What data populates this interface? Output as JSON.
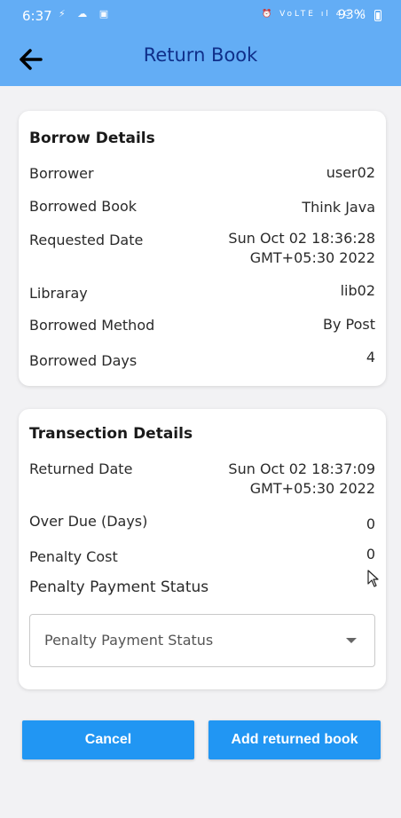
{
  "status_bar": {
    "time": "6:37",
    "left_icons": "⚡ ☁ ▣",
    "right_icons": "⏰ VoLTE ıl 4G ıl",
    "battery": "93%"
  },
  "header": {
    "title": "Return Book",
    "back_icon": "arrow-left-icon"
  },
  "borrow_details": {
    "title": "Borrow Details",
    "rows": [
      {
        "label": "Borrower",
        "value": "user02"
      },
      {
        "label": "Borrowed Book",
        "value": "Think Java"
      },
      {
        "label": "Requested Date",
        "value_line1": "Sun Oct 02 18:36:28",
        "value_line2": "GMT+05:30 2022"
      },
      {
        "label": "Libraray",
        "value": "lib02"
      },
      {
        "label": "Borrowed Method",
        "value": "By Post"
      },
      {
        "label": "Borrowed Days",
        "value": "4"
      }
    ]
  },
  "transaction_details": {
    "title": "Transection Details",
    "rows": [
      {
        "label": "Returned Date",
        "value_line1": "Sun Oct 02 18:37:09",
        "value_line2": "GMT+05:30 2022"
      },
      {
        "label": "Over Due (Days)",
        "value": "0"
      },
      {
        "label": "Penalty Cost",
        "value": "0"
      }
    ],
    "penalty_status_label": "Penalty Payment Status",
    "penalty_status_placeholder": "Penalty Payment Status"
  },
  "actions": {
    "cancel_label": "Cancel",
    "submit_label": "Add returned book"
  },
  "colors": {
    "app_bar": "#63adf5",
    "title": "#0f2f8a",
    "button": "#2196f3"
  }
}
